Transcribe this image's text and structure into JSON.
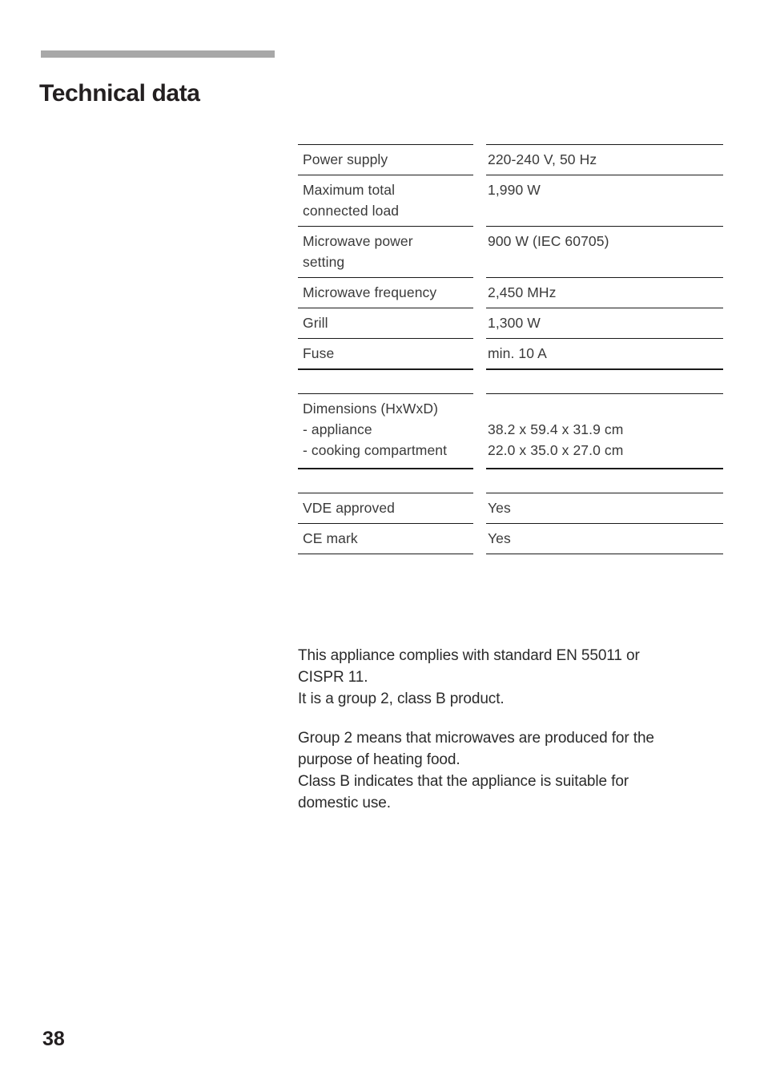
{
  "page": {
    "title": "Technical data",
    "number": "38",
    "accent_bar_color": "#a8a8a8",
    "rule_color": "#1a1a1a",
    "text_color": "#2b2b2b"
  },
  "spec_table": {
    "blocks": [
      {
        "rows": [
          {
            "label": "Power supply",
            "value": "220-240 V, 50 Hz"
          },
          {
            "label": "Maximum  total\nconnected  load",
            "value": "1,990 W"
          },
          {
            "label": "Microwave  power\nsetting",
            "value": "900 W (IEC 60705)"
          },
          {
            "label": "Microwave  frequency",
            "value": "2,450 MHz"
          },
          {
            "label": "Grill",
            "value": "1,300 W"
          },
          {
            "label": "Fuse",
            "value": "min. 10 A"
          }
        ]
      },
      {
        "rows": [
          {
            "label": "Dimensions  (HxWxD)\n-  appliance\n-  cooking  compartment",
            "value": "\n38.2 x 59.4 x 31.9 cm\n22.0 x 35.0 x 27.0 cm",
            "label_lines": [
              "Dimensions  (HxWxD)",
              "-  appliance",
              "-  cooking  compartment"
            ],
            "value_lines": [
              "",
              "38.2 x 59.4 x 31.9 cm",
              "22.0 x 35.0 x 27.0 cm"
            ]
          }
        ]
      },
      {
        "rows": [
          {
            "label": "VDE  approved",
            "value": "Yes"
          },
          {
            "label": "CE mark",
            "value": "Yes"
          }
        ]
      }
    ],
    "flat_rows": {
      "power_supply_label": "Power supply",
      "power_supply_value": "220-240 V, 50 Hz",
      "max_load_label_line1": "Maximum  total",
      "max_load_label_line2": "connected  load",
      "max_load_value": "1,990 W",
      "mw_power_label_line1": "Microwave  power",
      "mw_power_label_line2": "setting",
      "mw_power_value": "900 W (IEC 60705)",
      "mw_freq_label": "Microwave  frequency",
      "mw_freq_value": "2,450 MHz",
      "grill_label": "Grill",
      "grill_value": "1,300 W",
      "fuse_label": "Fuse",
      "fuse_value": "min. 10 A",
      "dimensions_heading": "Dimensions  (HxWxD)",
      "dimensions_appliance_label": "-  appliance",
      "dimensions_appliance_value": "38.2 x 59.4 x 31.9 cm",
      "dimensions_cavity_label": "-  cooking  compartment",
      "dimensions_cavity_value": "22.0 x 35.0 x 27.0 cm",
      "vde_label": "VDE  approved",
      "vde_value": "Yes",
      "ce_label": "CE mark",
      "ce_value": "Yes"
    }
  },
  "notes": {
    "paragraph_1_line_1": "This appliance complies with standard EN 55011 or",
    "paragraph_1_line_2": "CISPR 11.",
    "paragraph_1_line_3": "It is a group 2, class B product.",
    "paragraph_2_line_1": "Group 2 means that microwaves are produced for the",
    "paragraph_2_line_2": "purpose of heating food.",
    "paragraph_2_line_3": "Class B indicates that the appliance is suitable for",
    "paragraph_2_line_4": "domestic use."
  }
}
